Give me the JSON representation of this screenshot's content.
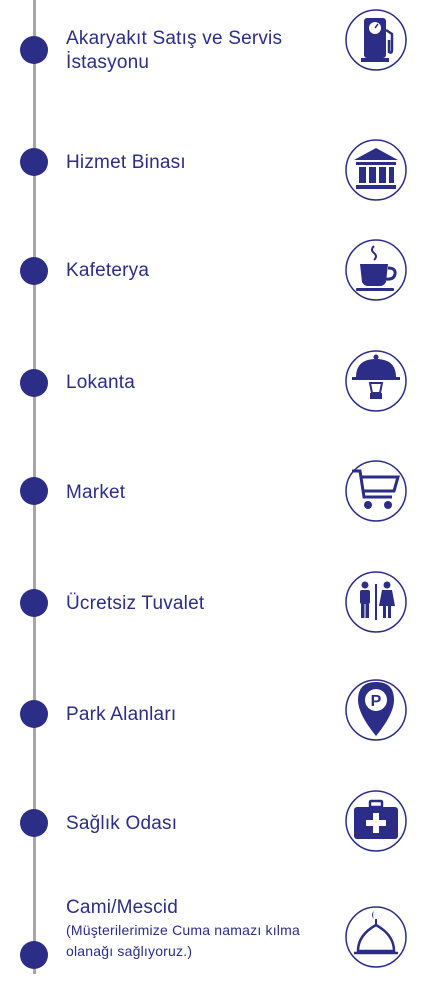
{
  "colors": {
    "primary": "#2b2d86",
    "line": "#a7a7a7"
  },
  "items": [
    {
      "label": "Akaryakıt Satış ve Servis İstasyonu",
      "icon": "fuel-pump-icon"
    },
    {
      "label": "Hizmet Binası",
      "icon": "building-icon"
    },
    {
      "label": "Kafeterya",
      "icon": "coffee-cup-icon"
    },
    {
      "label": "Lokanta",
      "icon": "food-cloche-icon"
    },
    {
      "label": "Market",
      "icon": "shopping-cart-icon"
    },
    {
      "label": "Ücretsiz Tuvalet",
      "icon": "restroom-icon"
    },
    {
      "label": "Park Alanları",
      "icon": "parking-pin-icon"
    },
    {
      "label": "Sağlık Odası",
      "icon": "first-aid-kit-icon"
    },
    {
      "label": "Cami/Mescid",
      "sub": "(Müşterilerimize Cuma namazı kılma olanağı sağlıyoruz.)",
      "icon": "mosque-icon"
    }
  ]
}
